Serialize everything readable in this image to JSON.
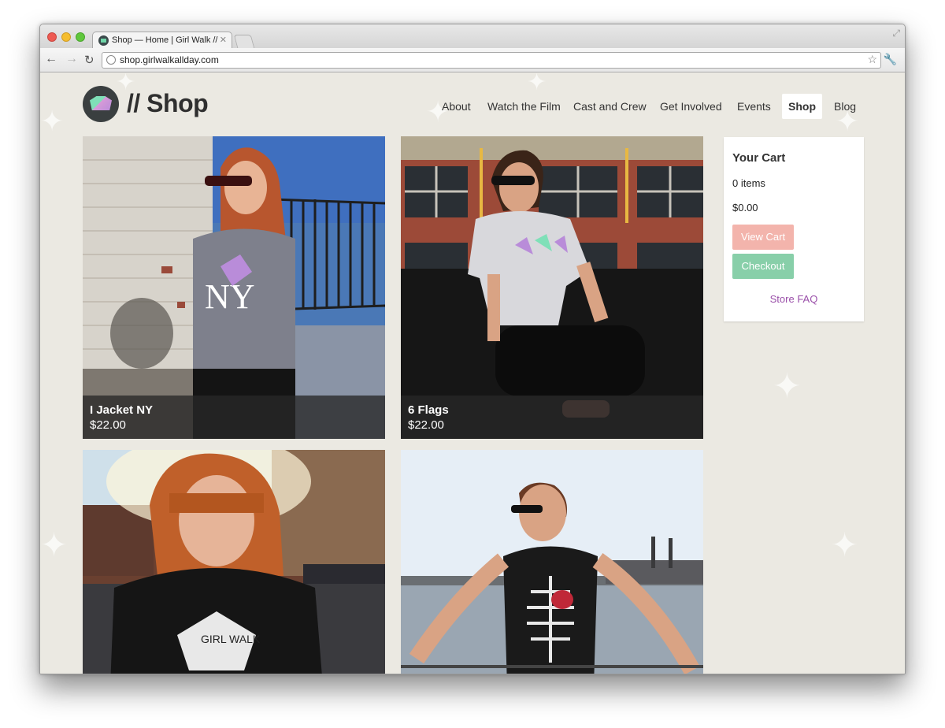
{
  "browser": {
    "tab_title": "Shop — Home | Girl Walk //",
    "url": "shop.girlwalkallday.com"
  },
  "header": {
    "title": "// Shop"
  },
  "nav": {
    "items": [
      {
        "label": "About"
      },
      {
        "label": "Watch the Film"
      },
      {
        "label": "Cast and Crew"
      },
      {
        "label": "Get Involved"
      },
      {
        "label": "Events"
      },
      {
        "label": "Shop",
        "active": true
      },
      {
        "label": "Blog"
      }
    ]
  },
  "products": [
    {
      "name": "I Jacket NY",
      "price": "$22.00"
    },
    {
      "name": "6 Flags",
      "price": "$22.00"
    },
    {
      "name": "",
      "price": ""
    },
    {
      "name": "",
      "price": ""
    }
  ],
  "cart": {
    "title": "Your Cart",
    "items": "0 items",
    "total": "$0.00",
    "view_label": "View Cart",
    "checkout_label": "Checkout",
    "faq_label": "Store FAQ"
  },
  "colors": {
    "page_bg": "#ebe9e2",
    "view_cart": "#f3b4ac",
    "checkout": "#88cfa9",
    "faq_link": "#9a4fa9"
  }
}
